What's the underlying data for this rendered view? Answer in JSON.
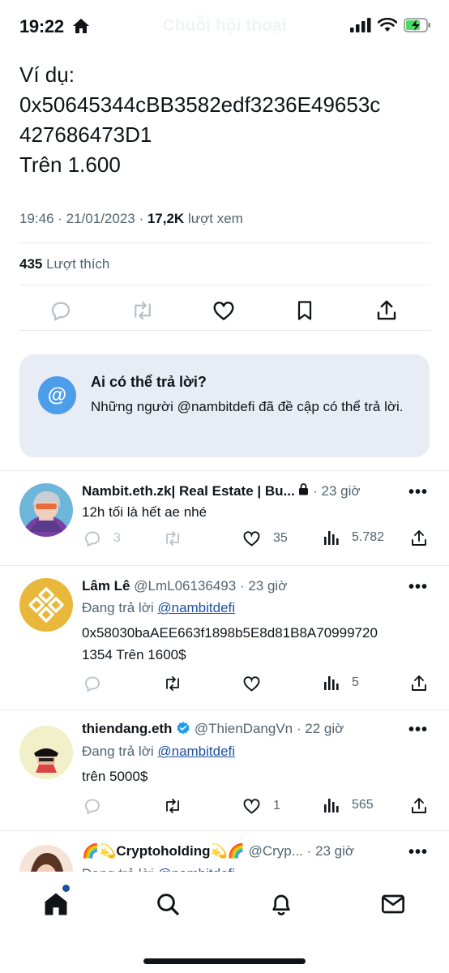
{
  "status_bar": {
    "time": "19:22"
  },
  "header": {
    "title": "Chuỗi hội thoại"
  },
  "tweet": {
    "lines": [
      "Ví dụ:",
      "0x50645344cBB3582edf3236E49653c",
      "427686473D1",
      "Trên 1.600"
    ],
    "time": "19:46 · 21/01/2023 · ",
    "views": "17,2K",
    "views_label": " lượt xem",
    "likes": "435",
    "likes_label": " Lượt thích"
  },
  "reply_restriction": {
    "title": "Ai có thể trả lời?",
    "description": "Những người @nambitdefi đã đề cập có thể trả lời."
  },
  "replies": [
    {
      "name": "Nambit.eth.zk| Real Estate | Bu...",
      "handle": "",
      "time": " · 23 giờ",
      "replying_prefix": "",
      "replying_mention": "",
      "text_lines": [
        "12h tối là hết ae nhé"
      ],
      "stats": {
        "replies": "3",
        "retweets": "",
        "likes": "35",
        "views": "5.782"
      }
    },
    {
      "name": "Lâm Lê",
      "handle": " @LmL06136493",
      "time": " · 23 giờ",
      "replying_prefix": "Đang trả lời ",
      "replying_mention": "@nambitdefi",
      "text_lines": [
        "0x58030baAEE663f1898b5E8d81B8A70999720",
        "1354 Trên 1600$"
      ],
      "stats": {
        "replies": "",
        "retweets": "",
        "likes": "",
        "views": "5"
      }
    },
    {
      "name": "thiendang.eth",
      "handle": " @ThienDangVn",
      "time": " · 22 giờ",
      "replying_prefix": "Đang trả lời ",
      "replying_mention": "@nambitdefi",
      "text_lines": [
        "trên 5000$"
      ],
      "stats": {
        "replies": "",
        "retweets": "",
        "likes": "1",
        "views": "565"
      }
    },
    {
      "name": "Cryptoholding",
      "name_emoji_left": "🌈💫",
      "name_emoji_right": "💫🌈",
      "handle": " @Cryp...",
      "time": " · 23 giờ",
      "replying_prefix": "Đang trả lời ",
      "replying_mention": "@nambitdefi"
    }
  ],
  "more_glyph": "•••",
  "icons": [
    "home-icon",
    "signal-icon",
    "wifi-icon",
    "battery-charging-icon",
    "reply-icon",
    "retweet-icon",
    "like-icon",
    "bookmark-icon",
    "share-icon",
    "views-icon",
    "verified-icon",
    "lock-icon",
    "search-icon",
    "notifications-icon",
    "messages-icon"
  ],
  "colors": {
    "accent": "#1d9bf0",
    "at_circle": "#4c9eeb",
    "mention": "#1d4fa1",
    "muted": "#536471",
    "card": "#e8ecf4",
    "battery": "#4cd964"
  }
}
